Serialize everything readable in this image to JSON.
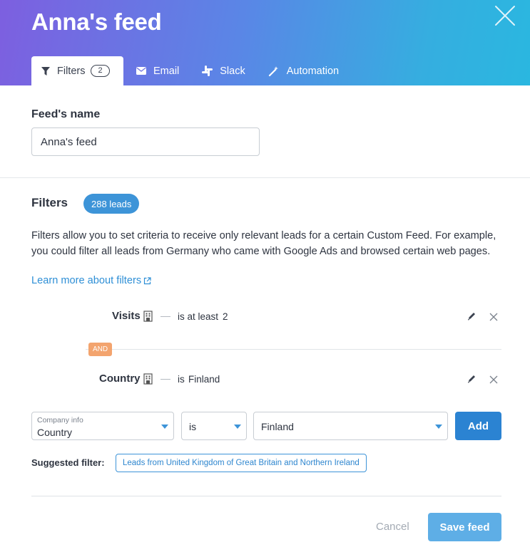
{
  "header": {
    "title": "Anna's feed",
    "tabs": [
      {
        "label": "Filters",
        "badge": "2",
        "icon": "filter-icon"
      },
      {
        "label": "Email",
        "icon": "envelope-icon"
      },
      {
        "label": "Slack",
        "icon": "slack-icon"
      },
      {
        "label": "Automation",
        "icon": "magic-wand-icon"
      }
    ]
  },
  "name_section": {
    "label": "Feed's name",
    "value": "Anna's feed"
  },
  "filters_section": {
    "title": "Filters",
    "leads_badge": "288 leads",
    "description": "Filters allow you to set criteria to receive only relevant leads for a certain Custom Feed. For example, you could filter all leads from Germany who came with Google Ads and browsed certain web pages.",
    "learn_more": "Learn more about filters"
  },
  "rules": [
    {
      "field": "Visits",
      "condition": "is at least",
      "value": "2"
    },
    {
      "field": "Country",
      "condition": "is",
      "value": "Finland"
    }
  ],
  "connector": "AND",
  "new_filter": {
    "category_label": "Company info",
    "field": "Country",
    "operator": "is",
    "value": "Finland",
    "add_label": "Add"
  },
  "suggested": {
    "label": "Suggested filter:",
    "chip": "Leads from United Kingdom of Great Britain and Northern Ireland"
  },
  "footer": {
    "cancel_label": "Cancel",
    "save_label": "Save feed"
  },
  "colors": {
    "accent": "#2b83d2",
    "badge": "#3d94d8",
    "and_badge": "#f3a46e"
  }
}
